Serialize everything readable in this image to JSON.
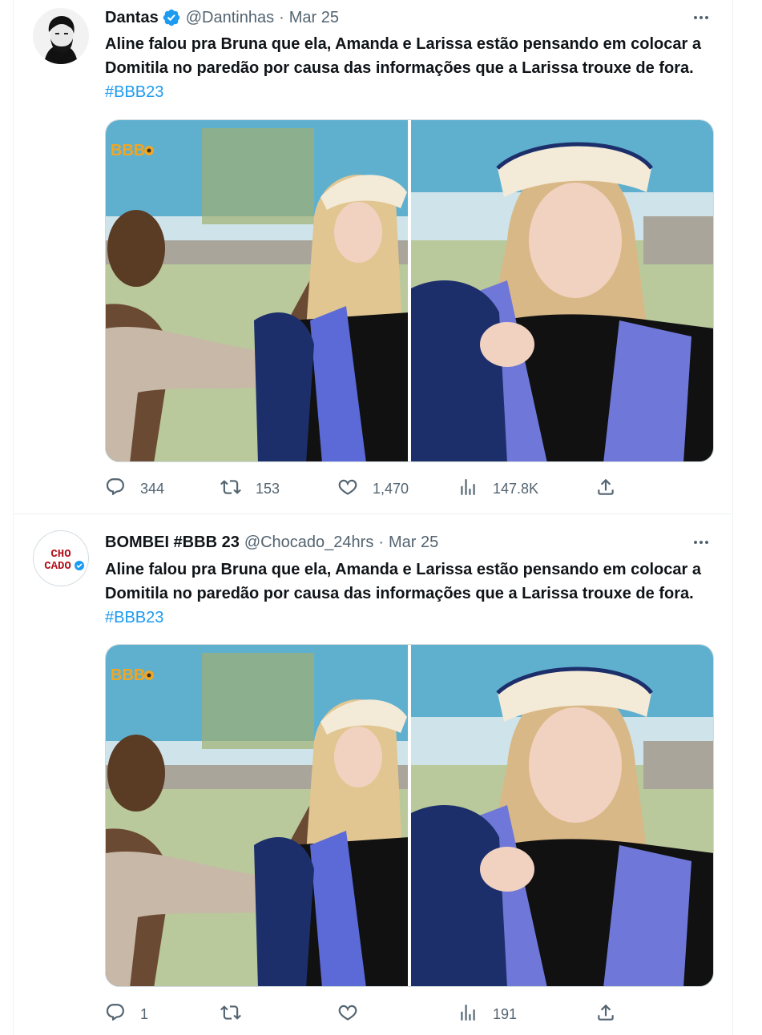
{
  "tweets": [
    {
      "display_name": "Dantas",
      "verified": true,
      "handle": "@Dantinhas",
      "separator": "·",
      "date": "Mar 25",
      "text": "Aline falou pra Bruna que ela, Amanda e Larissa estão pensando em colocar a Domitila no paredão por causa das informações que a Larissa trouxe de fora.",
      "hashtag": "#BBB23",
      "media_watermark": "BBB",
      "stats": {
        "replies": "344",
        "retweets": "153",
        "likes": "1,470",
        "views": "147.8K"
      }
    },
    {
      "display_name": "BOMBEI #BBB 23",
      "verified": false,
      "handle": "@Chocado_24hrs",
      "separator": "·",
      "date": "Mar 25",
      "avatar_logo": {
        "line1": "CHO",
        "line2": "CADO"
      },
      "text": "Aline falou pra Bruna que ela, Amanda e Larissa estão pensando em colocar a Domitila no paredão por causa das informações que a Larissa trouxe de fora.",
      "hashtag": "#BBB23",
      "media_watermark": "BBB",
      "stats": {
        "replies": "1",
        "retweets": "",
        "likes": "",
        "views": "191"
      }
    }
  ],
  "icons": {
    "verified": "verified-badge-icon",
    "more": "more-dots-icon",
    "reply": "reply-icon",
    "retweet": "retweet-icon",
    "like": "heart-icon",
    "views": "views-chart-icon",
    "share": "share-icon"
  },
  "colors": {
    "accent": "#1d9bf0",
    "text": "#0f1419",
    "muted": "#536471",
    "border": "#eff3f4"
  }
}
